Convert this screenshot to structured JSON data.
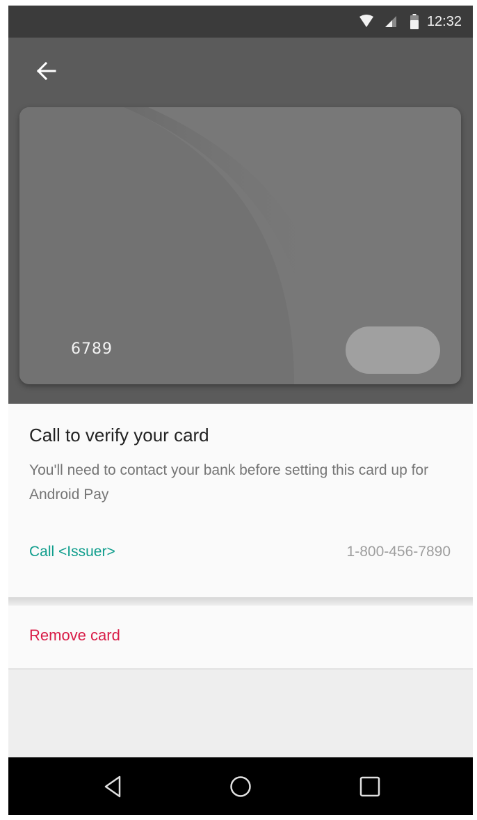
{
  "status_bar": {
    "time": "12:32",
    "icons": [
      "wifi-icon",
      "cellular-signal-icon",
      "battery-icon"
    ]
  },
  "app_bar": {
    "back_icon": "arrow-left-icon"
  },
  "card": {
    "last_digits": "6789",
    "logo": "issuer-logo-placeholder"
  },
  "verify": {
    "title": "Call to verify your card",
    "body": "You'll need to contact your bank before setting this card up for Android Pay",
    "call_label": "Call <Issuer>",
    "phone": "1-800-456-7890"
  },
  "actions": {
    "remove_label": "Remove card"
  },
  "navigation": {
    "buttons": [
      "back-triangle-icon",
      "home-circle-icon",
      "recents-square-icon"
    ]
  },
  "colors": {
    "accent": "#0f9d8c",
    "destructive": "#d81b46",
    "hero_background": "#5b5b5b",
    "card_background": "#787878"
  }
}
